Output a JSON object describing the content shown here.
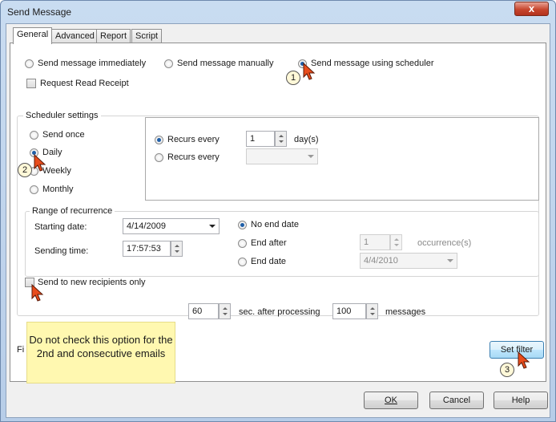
{
  "window": {
    "title": "Send Message",
    "close_glyph": "x"
  },
  "tabs": [
    {
      "label": "General"
    },
    {
      "label": "Advanced"
    },
    {
      "label": "Report"
    },
    {
      "label": "Script"
    }
  ],
  "send_mode": {
    "immediately": "Send message immediately",
    "manually": "Send message manually",
    "scheduler": "Send message using scheduler",
    "selected": "scheduler"
  },
  "read_receipt": {
    "label": "Request Read Receipt",
    "checked": false
  },
  "scheduler": {
    "group_label": "Scheduler settings",
    "options": [
      "Send once",
      "Daily",
      "Weekly",
      "Monthly"
    ],
    "selected": "Daily",
    "recurs_every_label": "Recurs every",
    "recurs_every_value": "1",
    "recurs_every_unit": "day(s)",
    "recurs_every_2_label": "Recurs every",
    "recurs_every_2_value": ""
  },
  "range": {
    "group_label": "Range of recurrence",
    "starting_date_label": "Starting date:",
    "starting_date_value": "4/14/2009",
    "sending_time_label": "Sending time:",
    "sending_time_value": "17:57:53",
    "no_end_label": "No end date",
    "end_after_label": "End after",
    "end_after_value": "1",
    "occurrences_label": "occurrence(s)",
    "end_date_label": "End date",
    "end_date_value": "4/4/2010",
    "selected_end": "no_end"
  },
  "new_recipients": {
    "label": "Send to new recipients only",
    "checked": false
  },
  "throttle": {
    "delay_value": "60",
    "delay_label": "sec. after processing",
    "count_value": "100",
    "count_label": "messages"
  },
  "filter": {
    "partial_label": "Fi",
    "set_filter_label": "Set filter"
  },
  "note": "Do not check this option for the 2nd and consecutive emails",
  "callouts": [
    "1",
    "2",
    "3"
  ],
  "buttons": {
    "ok": "OK",
    "cancel": "Cancel",
    "help": "Help"
  },
  "colors": {
    "note_bg": "#fff8b0",
    "callout_bg": "#fff8d8",
    "cursor": "#e84c1c"
  }
}
